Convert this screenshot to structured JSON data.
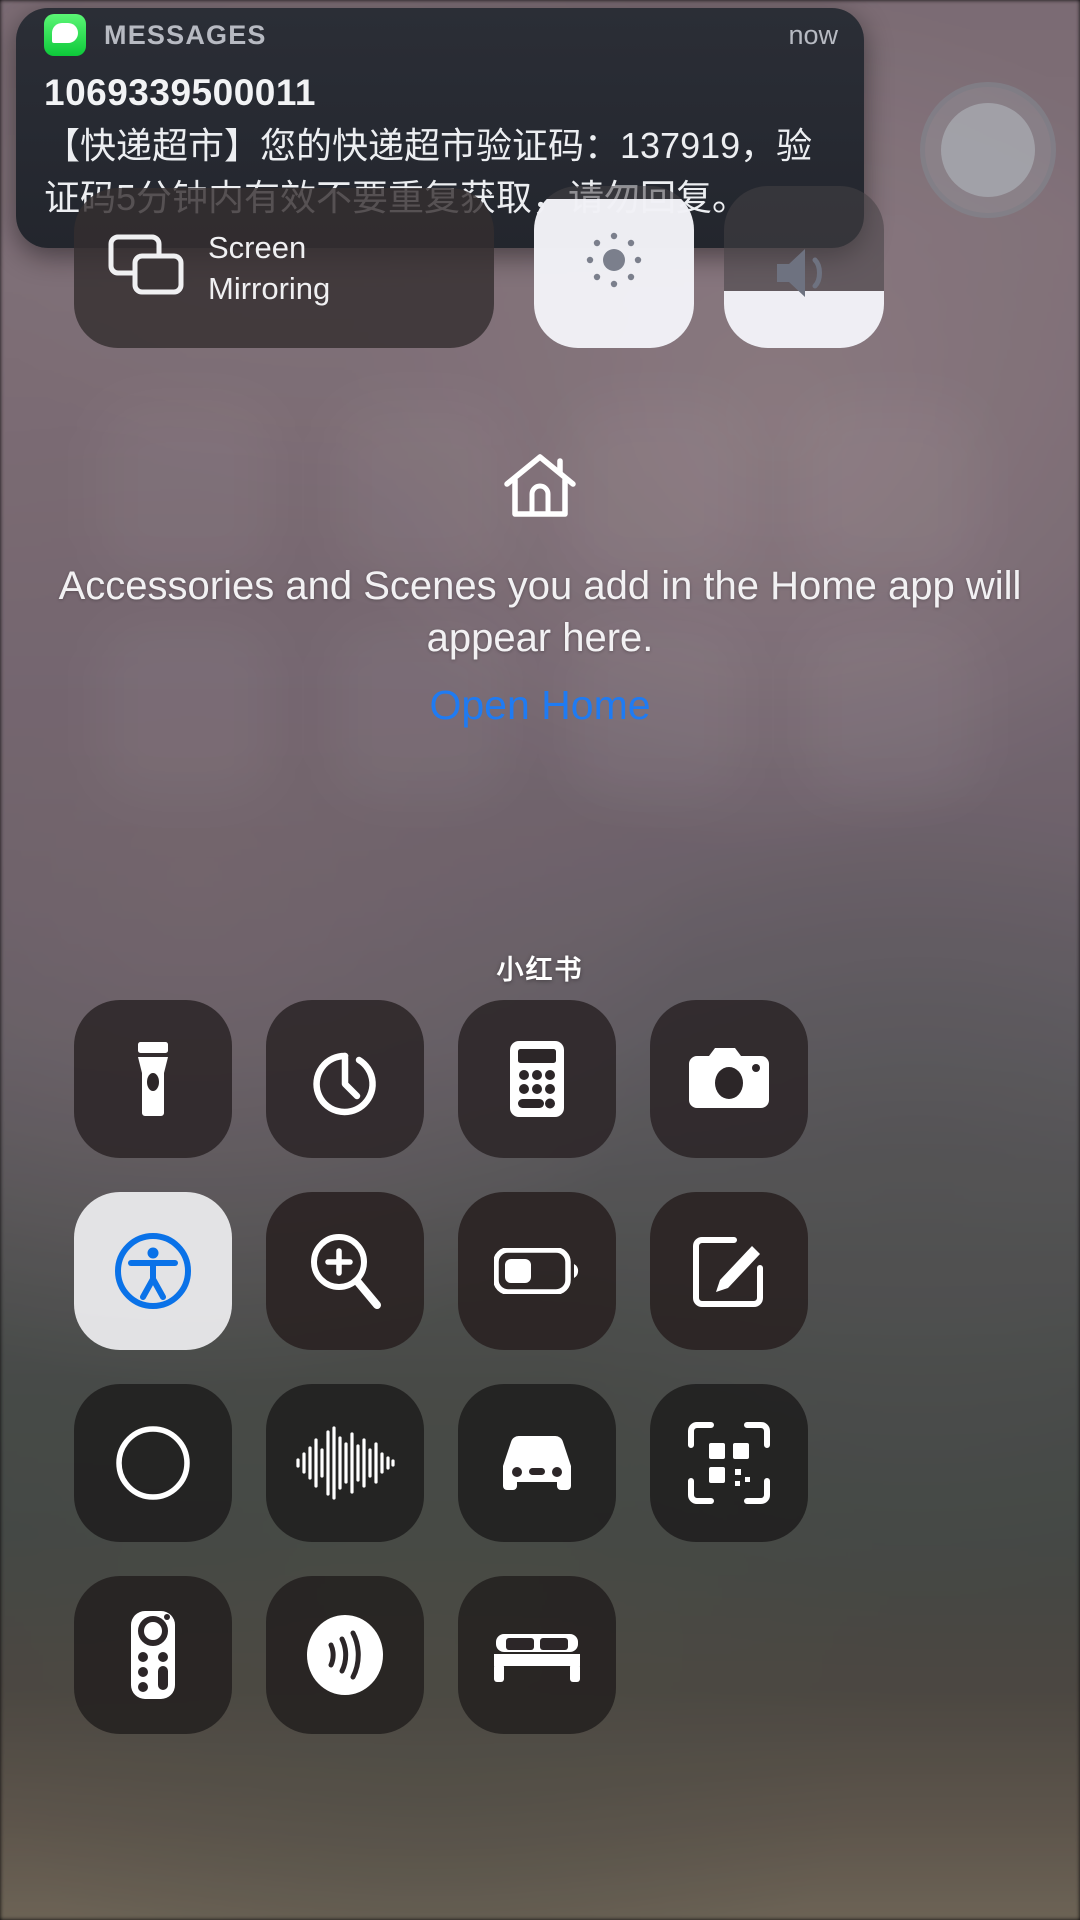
{
  "notification": {
    "app_name": "MESSAGES",
    "timestamp": "now",
    "sender": "1069339500011",
    "body": "【快递超市】您的快递超市验证码：137919，验证码5分钟内有效不要重复获取，请勿回复。",
    "app_icon": "messages-icon"
  },
  "top_controls": {
    "screen_mirroring": {
      "label_line1": "Screen",
      "label_line2": "Mirroring",
      "icon": "screen-mirroring-icon"
    },
    "brightness": {
      "icon": "brightness-icon",
      "level_percent": 92
    },
    "volume": {
      "icon": "volume-icon",
      "level_percent": 35
    }
  },
  "home_section": {
    "icon": "home-icon",
    "empty_message": "Accessories and Scenes you add in the Home app will appear here.",
    "link_label": "Open Home",
    "link_color": "#1f7bf2"
  },
  "watermark": {
    "text": "小红书"
  },
  "controls_grid": {
    "rows": [
      [
        {
          "name": "flashlight",
          "icon": "flashlight-icon",
          "active": false
        },
        {
          "name": "timer",
          "icon": "timer-icon",
          "active": false
        },
        {
          "name": "calculator",
          "icon": "calculator-icon",
          "active": false
        },
        {
          "name": "camera",
          "icon": "camera-icon",
          "active": false
        }
      ],
      [
        {
          "name": "accessibility-shortcuts",
          "icon": "accessibility-icon",
          "active": true
        },
        {
          "name": "magnifier",
          "icon": "magnifier-icon",
          "active": false
        },
        {
          "name": "low-power-mode",
          "icon": "battery-low-power-icon",
          "active": false
        },
        {
          "name": "notes",
          "icon": "notes-icon",
          "active": false
        }
      ],
      [
        {
          "name": "screen-recording",
          "icon": "record-circle-icon",
          "active": false
        },
        {
          "name": "voice-memos",
          "icon": "waveform-icon",
          "active": false
        },
        {
          "name": "driving-focus",
          "icon": "car-icon",
          "active": false
        },
        {
          "name": "code-scanner",
          "icon": "qr-scanner-icon",
          "active": false
        }
      ],
      [
        {
          "name": "apple-tv-remote",
          "icon": "remote-icon",
          "active": false
        },
        {
          "name": "nfc-tag-reader",
          "icon": "contactless-icon",
          "active": false
        },
        {
          "name": "sleep-mode",
          "icon": "bed-icon",
          "active": false
        }
      ]
    ]
  },
  "colors": {
    "accent_blue": "#1f7bf2",
    "tile_dark": "#2c2628",
    "tile_active": "#ececee",
    "notification_bg": "#262931"
  }
}
